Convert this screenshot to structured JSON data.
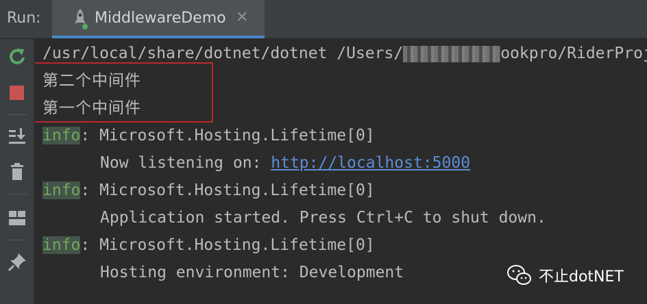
{
  "header": {
    "run_label": "Run:",
    "tab": {
      "title": "MiddlewareDemo",
      "close": "✕",
      "icon": "rocket-icon"
    }
  },
  "toolbar": {
    "buttons": [
      "rerun-icon",
      "stop-icon",
      "scroll-to-end-icon",
      "trash-icon",
      "layout-icon",
      "pin-icon"
    ]
  },
  "console": {
    "command": {
      "prefix": "/usr/local/share/dotnet/dotnet /Users/",
      "suffix": "ookpro/RiderProj"
    },
    "middleware_lines": [
      "第二个中间件",
      "第一个中间件"
    ],
    "log_entries": [
      {
        "tag": "info",
        "source": ": Microsoft.Hosting.Lifetime[0]",
        "message_prefix": "Now listening on: ",
        "link": "http://localhost:5000"
      },
      {
        "tag": "info",
        "source": ": Microsoft.Hosting.Lifetime[0]",
        "message": "Application started. Press Ctrl+C to shut down."
      },
      {
        "tag": "info",
        "source": ": Microsoft.Hosting.Lifetime[0]",
        "message": "Hosting environment: Development"
      }
    ]
  },
  "watermark": {
    "text": "不止dotNET"
  },
  "colors": {
    "background": "#2b2b2b",
    "panel": "#3c3f41",
    "accent": "#4a88c7",
    "stop": "#c75450",
    "rerun": "#59a869",
    "link": "#5c8ed6",
    "highlight": "#c0272d"
  }
}
